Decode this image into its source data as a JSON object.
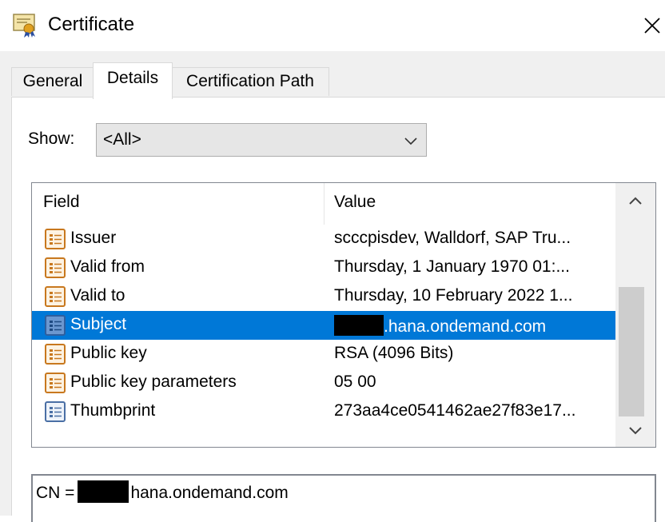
{
  "window": {
    "title": "Certificate",
    "close_glyph": "✕"
  },
  "tabs": [
    {
      "label": "General"
    },
    {
      "label": "Details"
    },
    {
      "label": "Certification Path"
    }
  ],
  "show": {
    "label": "Show:",
    "selected": "<All>"
  },
  "list": {
    "headers": {
      "field": "Field",
      "value": "Value"
    },
    "rows": [
      {
        "field": "Issuer",
        "value": "scccpisdev, Walldorf, SAP Tru...",
        "icon": "certificate-field-icon"
      },
      {
        "field": "Valid from",
        "value": "Thursday, 1 January 1970 01:...",
        "icon": "certificate-field-icon"
      },
      {
        "field": "Valid to",
        "value": "Thursday, 10 February 2022 1...",
        "icon": "certificate-field-icon"
      },
      {
        "field": "Subject",
        "value_suffix": ".hana.ondemand.com",
        "icon": "certificate-field-icon",
        "selected": true
      },
      {
        "field": "Public key",
        "value": "RSA (4096 Bits)",
        "icon": "certificate-field-icon"
      },
      {
        "field": "Public key parameters",
        "value": "05 00",
        "icon": "certificate-field-icon"
      },
      {
        "field": "Thumbprint",
        "value": "273aa4ce0541462ae27f83e17...",
        "icon": "certificate-properties-icon"
      }
    ]
  },
  "detail": {
    "prefix": "CN =",
    "suffix": "hana.ondemand.com"
  },
  "colors": {
    "selection": "#0078d7",
    "field_icon": "#c8781e",
    "properties_icon": "#4a6fa5"
  }
}
